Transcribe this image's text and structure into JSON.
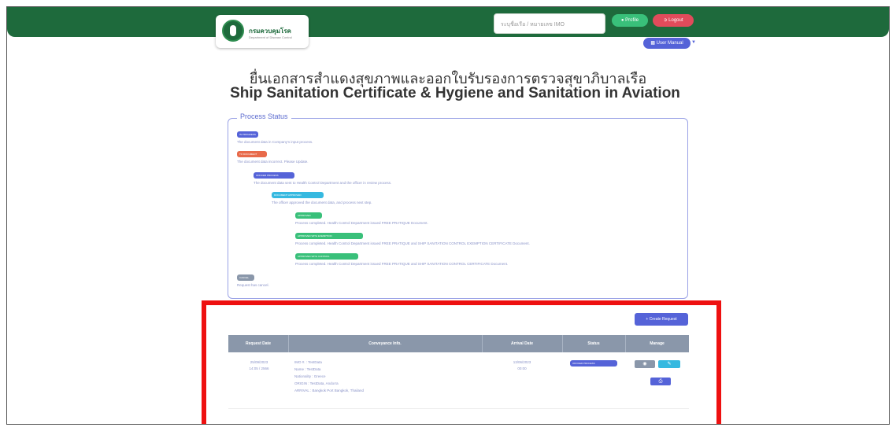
{
  "header": {
    "logo_text": "กรมควบคุมโรค",
    "logo_sub": "Department of Disease Control",
    "search_placeholder": "ระบุชื่อเรือ / หมายเลข IMO",
    "btn_profile": "Profile",
    "btn_logout": "Logout",
    "btn_manual": "User Manual"
  },
  "titles": {
    "thai": "ยื่นเอกสารสำแดงสุขภาพและออกใบรับรองการตรวจสุขาภิบาลเรือ",
    "english": "Ship Sanitation Certificate & Hygiene and Sanitation in Aviation"
  },
  "process_status": {
    "legend": "Process Status",
    "items": [
      {
        "badge": "In Progress",
        "desc": "The document data in Company's input process."
      },
      {
        "badge": "To Document",
        "desc": "The document data incorrect. Please Update."
      },
      {
        "badge": "Officer Process",
        "desc": "The document data sent to Health Control Department and the officer in review process."
      },
      {
        "badge": "Document Approved",
        "desc": "The officer approved the document data, and process next step."
      },
      {
        "badge": "Approved",
        "desc": "Process completed. Health Control Department issued FREE PRATIQUE Document."
      },
      {
        "badge": "Approved with Exemption",
        "desc": "Process completed. Health Control Department issued FREE PRATIQUE and SHIP SANITATION CONTROL EXEMPTION CERTIFICATE Document."
      },
      {
        "badge": "Approved with Control",
        "desc": "Process completed. Health Control Department issued FREE PRATIQUE and SHIP SANITATION CONTROL CERTIFICATE Document."
      },
      {
        "badge": "Cancel",
        "desc": "Request has cancel."
      }
    ],
    "colors": [
      "#5563d8",
      "#e86a4a",
      "#5563d8",
      "#36b9e0",
      "#39c07a",
      "#39c07a",
      "#39c07a",
      "#8a97aa"
    ]
  },
  "requests": {
    "create_button": "+ Create Request",
    "columns": [
      "Request Date",
      "Conveyance Info.",
      "Arrival Date",
      "Status",
      "Manage"
    ],
    "rows": [
      {
        "request_date": "25/09/2023",
        "request_time": "14:05 / 2566",
        "info": [
          "IMO #. : TestData",
          "Name : TestData",
          "Nationality : Greece",
          "ORIGIN : TestData, Andorra",
          "ARRIVAL : Bangkok Port Bangkok, Thailand"
        ],
        "arrival_date": "13/06/2023",
        "arrival_time": "00:00",
        "status": "Officer Process"
      }
    ]
  }
}
